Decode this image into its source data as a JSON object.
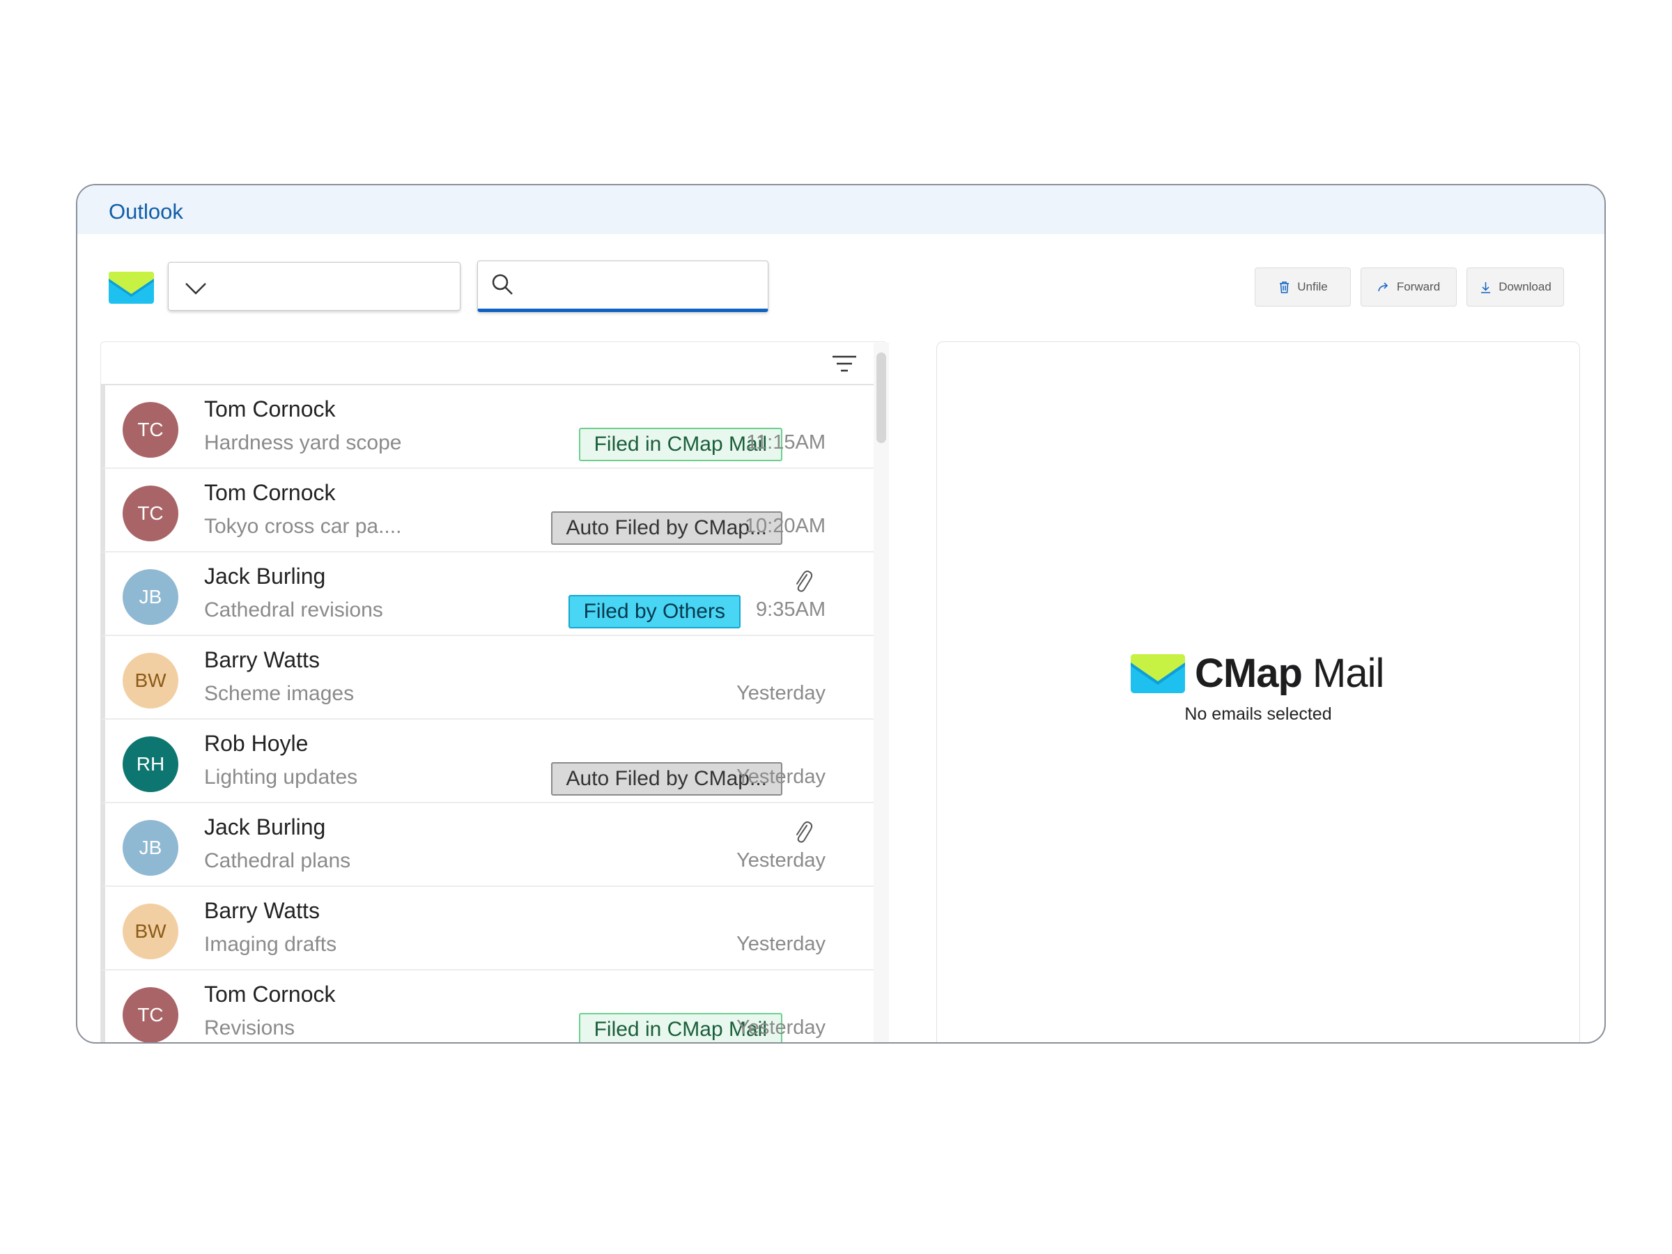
{
  "window": {
    "title": "Outlook"
  },
  "toolbar": {
    "folder_value": "",
    "search_placeholder": "",
    "unfile_label": "Unfile",
    "forward_label": "Forward",
    "download_label": "Download"
  },
  "emails": [
    {
      "initials": "TC",
      "sender": "Tom Cornock",
      "subject": "Hardness yard scope",
      "time": "11:15AM",
      "tag": "Filed in CMap Mail",
      "attachment": false
    },
    {
      "initials": "TC",
      "sender": "Tom Cornock",
      "subject": "Tokyo cross car pa....",
      "time": "10:20AM",
      "tag": "Auto Filed by CMap...",
      "attachment": false
    },
    {
      "initials": "JB",
      "sender": "Jack Burling",
      "subject": "Cathedral revisions",
      "time": "9:35AM",
      "tag": "Filed by Others",
      "attachment": true
    },
    {
      "initials": "BW",
      "sender": "Barry Watts",
      "subject": "Scheme images",
      "time": "Yesterday",
      "tag": "",
      "attachment": false
    },
    {
      "initials": "RH",
      "sender": "Rob Hoyle",
      "subject": "Lighting updates",
      "time": "Yesterday",
      "tag": "Auto Filed by CMap...",
      "attachment": false
    },
    {
      "initials": "JB",
      "sender": "Jack Burling",
      "subject": "Cathedral plans",
      "time": "Yesterday",
      "tag": "",
      "attachment": true
    },
    {
      "initials": "BW",
      "sender": "Barry Watts",
      "subject": "Imaging drafts",
      "time": "Yesterday",
      "tag": "",
      "attachment": false
    },
    {
      "initials": "TC",
      "sender": "Tom Cornock",
      "subject": "Revisions",
      "time": "Yesterday",
      "tag": "Filed in CMap Mail",
      "attachment": false
    }
  ],
  "preview": {
    "brand_part1": "CMap",
    "brand_part2": " Mail",
    "empty_message": "No emails selected"
  },
  "colors": {
    "accent": "#0f62c2",
    "avatar_tc": "#a86466",
    "avatar_jb": "#8fb8d2",
    "avatar_bw": "#f2cfa3",
    "avatar_rh": "#0e7670",
    "tag_filed_bg": "#e9f8ee",
    "tag_auto_bg": "#d9d9d9",
    "tag_others_bg": "#49d6f5"
  }
}
